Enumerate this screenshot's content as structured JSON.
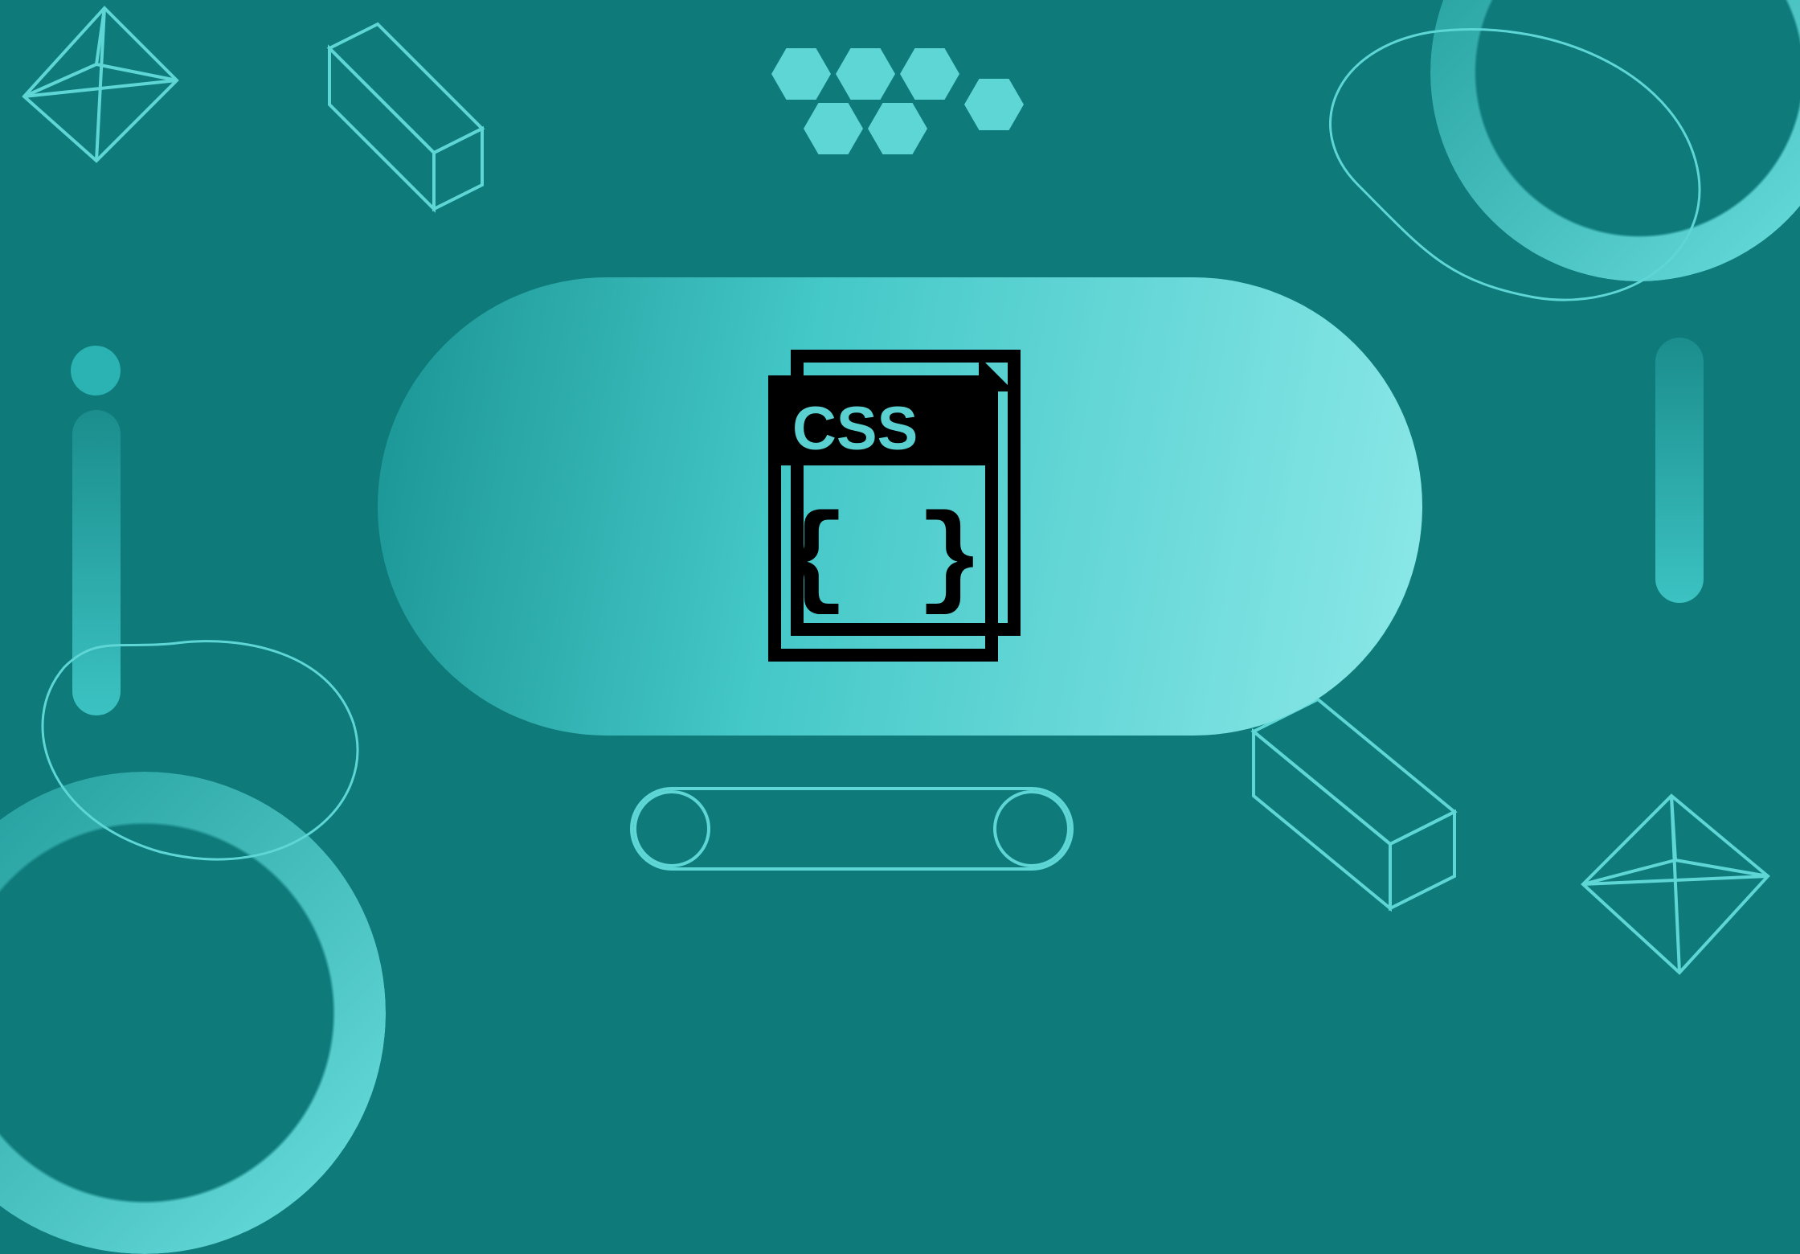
{
  "background_color": "#0e7a7a",
  "accent_color": "#5fd6d6",
  "card_gradient": [
    "#1a9494",
    "#45c8c8",
    "#8ce8e8"
  ],
  "center_icon": {
    "label": "CSS",
    "braces": "{ }",
    "kind": "css-file-stack"
  },
  "decor": {
    "wire_diamond_top_left": true,
    "prism_top": true,
    "hex_cluster": 6,
    "ring_top_right": true,
    "ring_bottom_left": true,
    "vertical_pills": 2,
    "capsule_outline": true,
    "prism_bottom_right": true,
    "wire_diamond_bottom_right": true,
    "blobs": 3
  }
}
